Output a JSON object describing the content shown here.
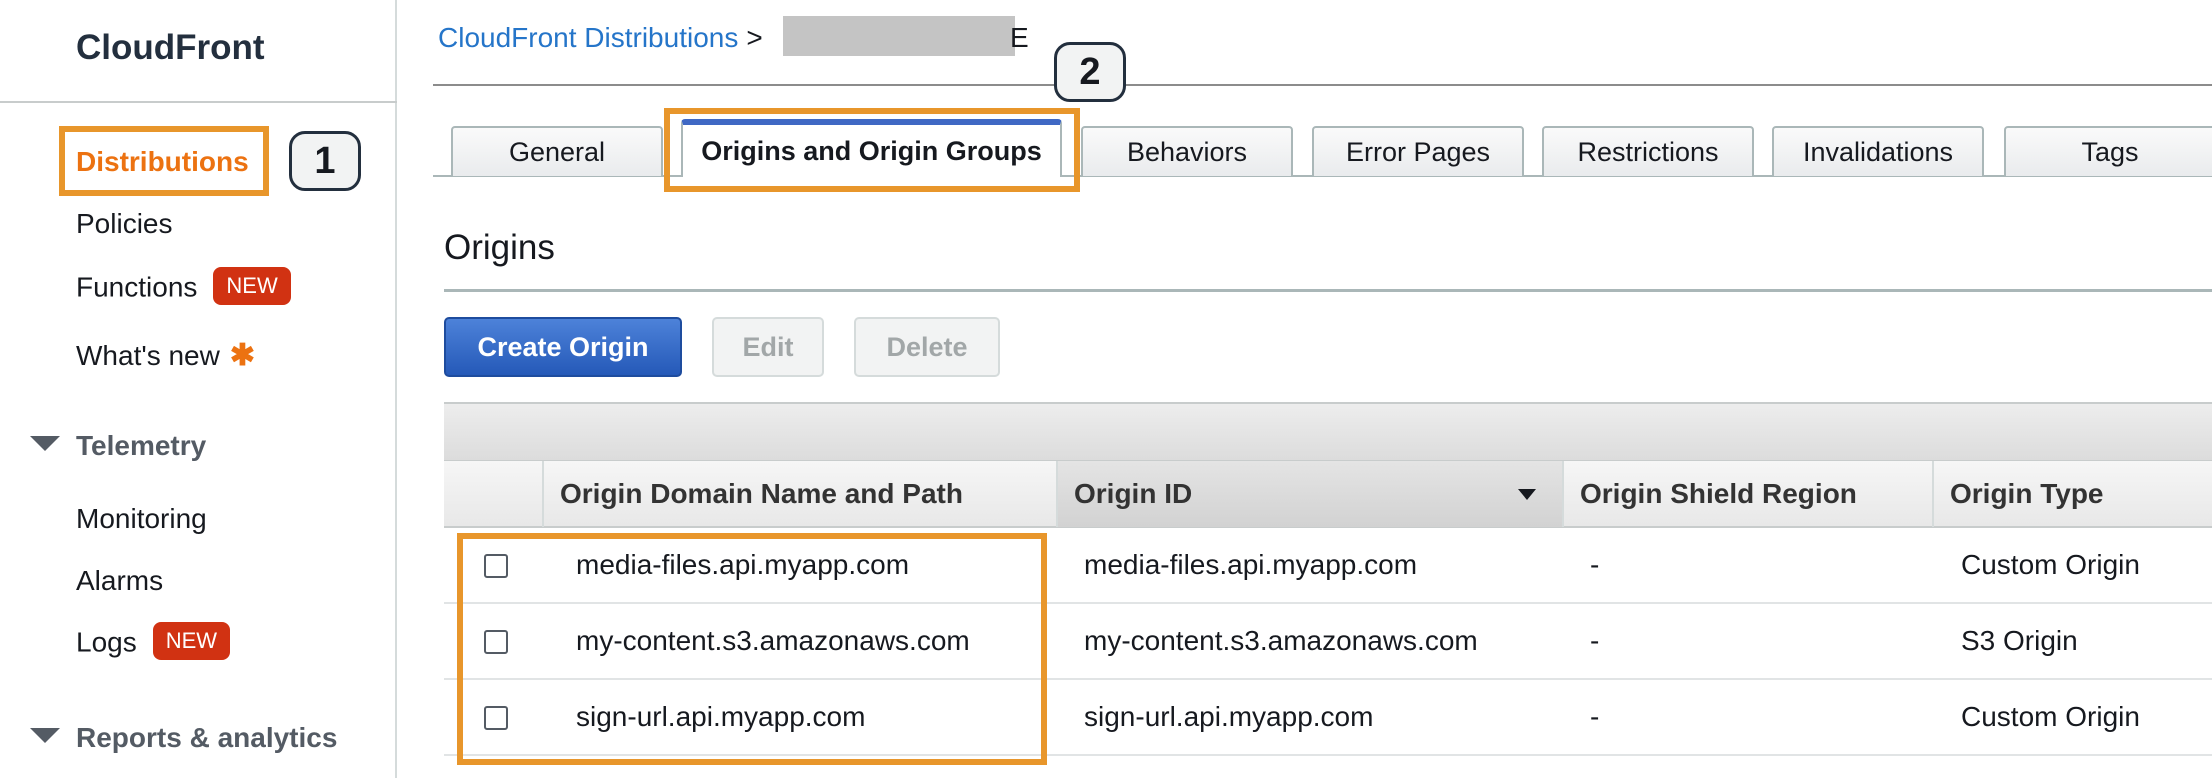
{
  "sidebar": {
    "brand": "CloudFront",
    "items": [
      {
        "label": "Distributions"
      },
      {
        "label": "Policies"
      },
      {
        "label": "Functions",
        "badge": "NEW"
      },
      {
        "label": "What's new",
        "marker": "✱"
      }
    ],
    "telemetry": {
      "header": "Telemetry",
      "items": [
        {
          "label": "Monitoring"
        },
        {
          "label": "Alarms"
        },
        {
          "label": "Logs",
          "badge": "NEW"
        }
      ]
    },
    "reports_header": "Reports & analytics"
  },
  "callouts": {
    "one": "1",
    "two": "2"
  },
  "breadcrumb": {
    "link": "CloudFront Distributions",
    "separator": ">",
    "current_visible_fragment": "E"
  },
  "tabs": [
    {
      "label": "General"
    },
    {
      "label": "Origins and Origin Groups",
      "active": true
    },
    {
      "label": "Behaviors"
    },
    {
      "label": "Error Pages"
    },
    {
      "label": "Restrictions"
    },
    {
      "label": "Invalidations"
    },
    {
      "label": "Tags"
    }
  ],
  "section": {
    "title": "Origins"
  },
  "buttons": {
    "create": "Create Origin",
    "edit": "Edit",
    "delete": "Delete"
  },
  "table": {
    "columns": [
      "Origin Domain Name and Path",
      "Origin ID",
      "Origin Shield Region",
      "Origin Type"
    ],
    "sorted_column": "Origin ID",
    "rows": [
      {
        "domain": "media-files.api.myapp.com",
        "id": "media-files.api.myapp.com",
        "shield": "-",
        "type": "Custom Origin"
      },
      {
        "domain": "my-content.s3.amazonaws.com",
        "id": "my-content.s3.amazonaws.com",
        "shield": "-",
        "type": "S3 Origin"
      },
      {
        "domain": "sign-url.api.myapp.com",
        "id": "sign-url.api.myapp.com",
        "shield": "-",
        "type": "Custom Origin"
      }
    ]
  },
  "colors": {
    "accent": "#ec7211",
    "callout_border": "#e8962b",
    "link": "#2575c9",
    "primary_button": "#2559b8",
    "badge": "#d13212",
    "active_tab_border": "#3f68c4"
  }
}
